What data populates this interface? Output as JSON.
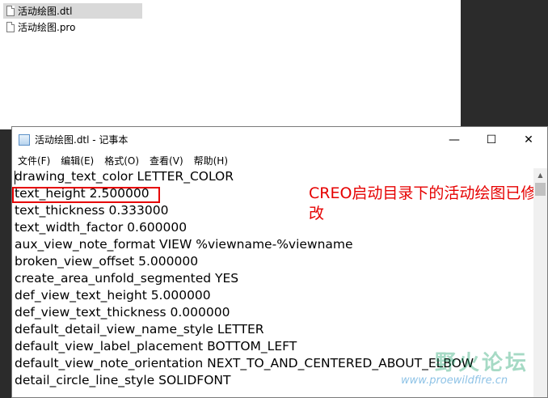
{
  "explorer": {
    "files": [
      {
        "name": "活动绘图.dtl",
        "selected": true
      },
      {
        "name": "活动绘图.pro",
        "selected": false
      }
    ]
  },
  "notepad": {
    "title": "活动绘图.dtl - 记事本",
    "window_buttons": {
      "minimize": "—",
      "maximize": "☐",
      "close": "✕"
    },
    "menu": [
      "文件(F)",
      "编辑(E)",
      "格式(O)",
      "查看(V)",
      "帮助(H)"
    ],
    "lines": [
      "drawing_text_color LETTER_COLOR",
      "text_height 2.500000",
      "text_thickness 0.333000",
      "text_width_factor 0.600000",
      "aux_view_note_format VIEW %viewname-%viewname",
      "broken_view_offset 5.000000",
      "create_area_unfold_segmented YES",
      "def_view_text_height 5.000000",
      "def_view_text_thickness 0.000000",
      "default_detail_view_name_style LETTER",
      "default_view_label_placement BOTTOM_LEFT",
      "default_view_note_orientation NEXT_TO_AND_CENTERED_ABOUT_ELBOW",
      "detail_circle_line_style SOLIDFONT"
    ]
  },
  "annotation": {
    "text": "CREO启动目录下的活动绘图已修改",
    "color": "#e60000"
  },
  "watermark": {
    "text": "野火论坛",
    "url": "www.proewildfire.cn"
  }
}
